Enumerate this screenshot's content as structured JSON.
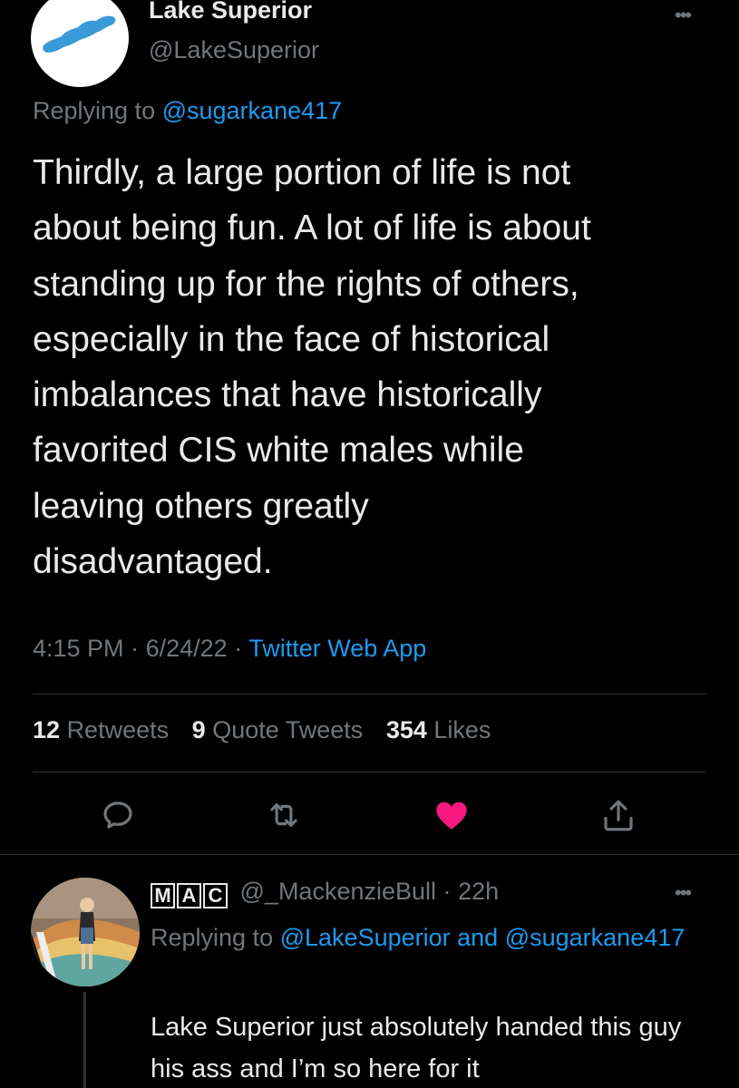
{
  "tweet": {
    "display_name": "Lake Superior",
    "handle": "@LakeSuperior",
    "more_icon": "more-dots-icon",
    "replying_prefix": "Replying to",
    "replying_to": "@sugarkane417",
    "text": "Thirdly, a large portion of life is not\nabout being fun. A lot of life is about\nstanding up for the rights of others,\nespecially in the face of historical\nimbalances that have historically\nfavorited CIS white males while\nleaving others greatly\ndisadvantaged.",
    "time": "4:15 PM",
    "date": "6/24/22",
    "separator": "·",
    "source": "Twitter Web App"
  },
  "stats": {
    "retweets_count": "12",
    "retweets_label": "Retweets",
    "quotes_count": "9",
    "quotes_label": "Quote Tweets",
    "likes_count": "354",
    "likes_label": "Likes"
  },
  "actions": {
    "reply_icon": "reply-icon",
    "retweet_icon": "retweet-icon",
    "like_icon": "heart-icon",
    "share_icon": "share-icon",
    "liked": true,
    "like_color": "#f91880"
  },
  "reply": {
    "logo_letters": [
      "M",
      "A",
      "C"
    ],
    "handle": "@_MackenzieBull",
    "time": "22h",
    "replying_prefix": "Replying to",
    "replying_to_1": "@LakeSuperior",
    "and": "and",
    "replying_to_2": "@sugarkane417",
    "text": "Lake Superior just absolutely handed this guy his ass and I’m so here for it"
  },
  "colors": {
    "background": "#000000",
    "text": "#e7e9ea",
    "secondary": "#71767b",
    "link": "#1d9bf0",
    "divider": "#2f3336",
    "lake_blue": "#3a9ad9"
  }
}
